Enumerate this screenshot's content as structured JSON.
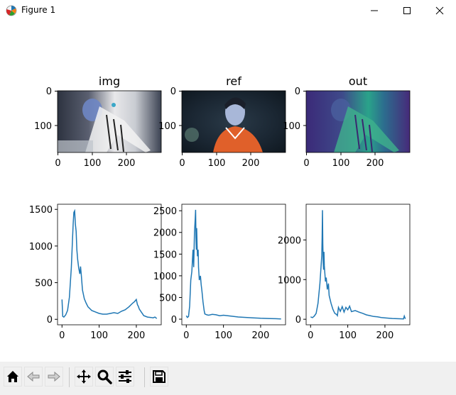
{
  "window": {
    "title": "Figure 1"
  },
  "icons": {
    "app": "matplotlib-icon",
    "minimize": "minimize-icon",
    "maximize": "maximize-icon",
    "close": "close-icon",
    "home": "home-icon",
    "back": "back-arrow-icon",
    "forward": "forward-arrow-icon",
    "pan": "pan-move-icon",
    "zoom": "zoom-magnifier-icon",
    "subplots": "configure-subplots-icon",
    "save": "save-disk-icon"
  },
  "colors": {
    "line": "#1f77b4",
    "toolbar": "#f0f0f0"
  },
  "images": [
    {
      "title": "img",
      "xticks": [
        "0",
        "100",
        "200"
      ],
      "yticks": [
        "0",
        "100"
      ]
    },
    {
      "title": "ref",
      "xticks": [
        "0",
        "100",
        "200"
      ],
      "yticks": [
        "0",
        "100"
      ]
    },
    {
      "title": "out",
      "xticks": [
        "0",
        "100",
        "200"
      ],
      "yticks": [
        "0",
        "100"
      ]
    }
  ],
  "chart_data": [
    {
      "type": "line",
      "name": "img",
      "xlim": [
        -12,
        267
      ],
      "ylim": [
        -75,
        1570
      ],
      "xticks": [
        0,
        100,
        200
      ],
      "yticks": [
        0,
        500,
        1000,
        1500
      ],
      "x": [
        0,
        2,
        5,
        10,
        15,
        20,
        25,
        28,
        30,
        32,
        34,
        36,
        38,
        40,
        42,
        45,
        48,
        50,
        52,
        55,
        60,
        65,
        70,
        80,
        90,
        100,
        110,
        120,
        130,
        140,
        150,
        160,
        170,
        180,
        190,
        195,
        200,
        203,
        205,
        208,
        212,
        220,
        230,
        240,
        245,
        250,
        255
      ],
      "values": [
        270,
        40,
        30,
        60,
        120,
        300,
        700,
        1050,
        1300,
        1460,
        1480,
        1300,
        1200,
        950,
        820,
        700,
        620,
        720,
        600,
        400,
        280,
        220,
        170,
        120,
        100,
        80,
        70,
        70,
        80,
        90,
        80,
        110,
        130,
        170,
        220,
        240,
        270,
        200,
        180,
        140,
        110,
        50,
        30,
        25,
        20,
        30,
        10
      ]
    },
    {
      "type": "line",
      "name": "ref",
      "xlim": [
        -12,
        267
      ],
      "ylim": [
        -130,
        2650
      ],
      "xticks": [
        0,
        100,
        200
      ],
      "yticks": [
        0,
        500,
        1000,
        1500,
        2000,
        2500
      ],
      "x": [
        0,
        3,
        6,
        9,
        12,
        15,
        18,
        20,
        22,
        24,
        25,
        26,
        27,
        28,
        29,
        30,
        32,
        33,
        35,
        38,
        40,
        42,
        45,
        48,
        50,
        55,
        60,
        70,
        80,
        90,
        100,
        120,
        140,
        160,
        180,
        200,
        220,
        240,
        255
      ],
      "values": [
        80,
        40,
        60,
        300,
        900,
        1100,
        1600,
        1200,
        2000,
        2300,
        2520,
        1900,
        1600,
        2100,
        1700,
        1450,
        1600,
        1200,
        900,
        1000,
        800,
        650,
        400,
        200,
        120,
        100,
        90,
        110,
        100,
        80,
        90,
        70,
        50,
        40,
        30,
        20,
        15,
        10,
        5
      ]
    },
    {
      "type": "line",
      "name": "out",
      "xlim": [
        -12,
        267
      ],
      "ylim": [
        -140,
        2900
      ],
      "xticks": [
        0,
        100,
        200
      ],
      "yticks": [
        0,
        1000,
        2000
      ],
      "x": [
        0,
        5,
        10,
        15,
        20,
        25,
        28,
        30,
        31,
        32,
        33,
        34,
        35,
        36,
        37,
        38,
        40,
        42,
        45,
        48,
        50,
        55,
        60,
        65,
        70,
        72,
        75,
        80,
        85,
        90,
        95,
        100,
        105,
        110,
        120,
        130,
        140,
        150,
        160,
        170,
        180,
        190,
        200,
        220,
        240,
        250,
        252,
        255
      ],
      "values": [
        60,
        40,
        80,
        150,
        400,
        900,
        1300,
        1600,
        2050,
        2750,
        1900,
        1400,
        1250,
        1700,
        1350,
        1200,
        950,
        1050,
        750,
        900,
        600,
        400,
        250,
        150,
        120,
        90,
        300,
        200,
        320,
        180,
        300,
        240,
        330,
        190,
        220,
        180,
        150,
        110,
        90,
        70,
        60,
        45,
        35,
        20,
        12,
        8,
        80,
        10
      ]
    }
  ],
  "hist_ticks": [
    {
      "x": [
        "0",
        "100",
        "200"
      ],
      "y": [
        "0",
        "500",
        "1000",
        "1500"
      ]
    },
    {
      "x": [
        "0",
        "100",
        "200"
      ],
      "y": [
        "0",
        "500",
        "1000",
        "1500",
        "2000",
        "2500"
      ]
    },
    {
      "x": [
        "0",
        "100",
        "200"
      ],
      "y": [
        "0",
        "1000",
        "2000"
      ]
    }
  ]
}
